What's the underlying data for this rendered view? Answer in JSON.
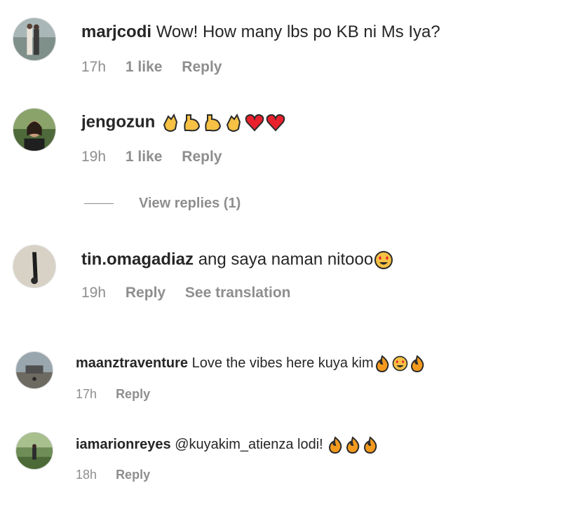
{
  "comments": [
    {
      "username": "marjcodi",
      "text": "Wow! How many lbs po KB ni Ms Iya?",
      "time": "17h",
      "likes": "1 like",
      "reply": "Reply"
    },
    {
      "username": "jengozun",
      "text": "",
      "emojis": [
        "clap-emoji",
        "flexed-bicep-emoji",
        "flexed-bicep-emoji",
        "clap-emoji",
        "red-heart-emoji",
        "red-heart-emoji"
      ],
      "time": "19h",
      "likes": "1 like",
      "reply": "Reply",
      "view_replies": "View replies (1)"
    },
    {
      "username": "tin.omagadiaz",
      "text": "ang saya naman nitooo",
      "emojis": [
        "heart-eyes-emoji"
      ],
      "time": "19h",
      "reply": "Reply",
      "translation": "See translation"
    },
    {
      "username": "maanztraventure",
      "text": "Love the vibes here kuya kim",
      "emojis": [
        "fire-emoji",
        "heart-eyes-emoji",
        "fire-emoji"
      ],
      "time": "17h",
      "reply": "Reply"
    },
    {
      "username": "iamarionreyes",
      "text": "@kuyakim_atienza lodi! ",
      "emojis": [
        "fire-emoji",
        "fire-emoji",
        "fire-emoji"
      ],
      "time": "18h",
      "reply": "Reply"
    }
  ],
  "colors": {
    "text": "#262626",
    "meta": "#8e8e8e",
    "background": "#ffffff"
  }
}
